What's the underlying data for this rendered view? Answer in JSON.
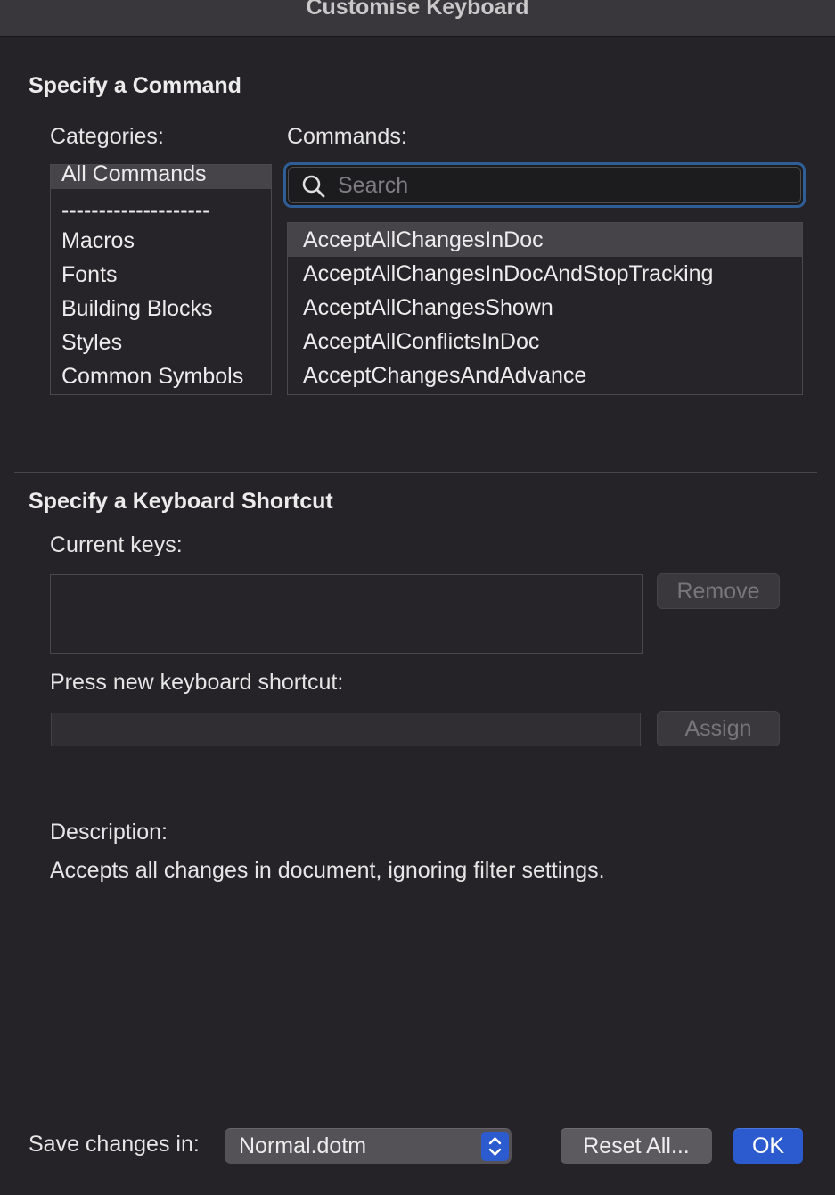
{
  "window": {
    "title": "Customise Keyboard"
  },
  "command_section": {
    "heading": "Specify a Command",
    "categories_label": "Categories:",
    "commands_label": "Commands:",
    "categories": [
      {
        "label": "All Commands",
        "selected": true
      },
      {
        "label": "--------------------",
        "selected": false
      },
      {
        "label": "Macros",
        "selected": false
      },
      {
        "label": "Fonts",
        "selected": false
      },
      {
        "label": "Building Blocks",
        "selected": false
      },
      {
        "label": "Styles",
        "selected": false
      },
      {
        "label": "Common Symbols",
        "selected": false
      }
    ],
    "search": {
      "placeholder": "Search",
      "value": ""
    },
    "commands": [
      {
        "label": "AcceptAllChangesInDoc",
        "selected": true
      },
      {
        "label": "AcceptAllChangesInDocAndStopTracking",
        "selected": false
      },
      {
        "label": "AcceptAllChangesShown",
        "selected": false
      },
      {
        "label": "AcceptAllConflictsInDoc",
        "selected": false
      },
      {
        "label": "AcceptChangesAndAdvance",
        "selected": false
      }
    ]
  },
  "shortcut_section": {
    "heading": "Specify a Keyboard Shortcut",
    "current_keys_label": "Current keys:",
    "remove_button": "Remove",
    "new_shortcut_label": "Press new keyboard shortcut:",
    "new_shortcut_value": "",
    "assign_button": "Assign",
    "description_label": "Description:",
    "description_text": "Accepts all changes in document, ignoring filter settings."
  },
  "footer": {
    "save_changes_label": "Save changes in:",
    "save_changes_value": "Normal.dotm",
    "reset_button": "Reset All...",
    "ok_button": "OK"
  },
  "icons": {
    "search": "search-icon",
    "popup": "chevron-up-down-icon"
  },
  "colors": {
    "background": "#252327",
    "focus_ring": "#2f5e96",
    "primary_button": "#2b5bcf",
    "selection": "#464449"
  }
}
